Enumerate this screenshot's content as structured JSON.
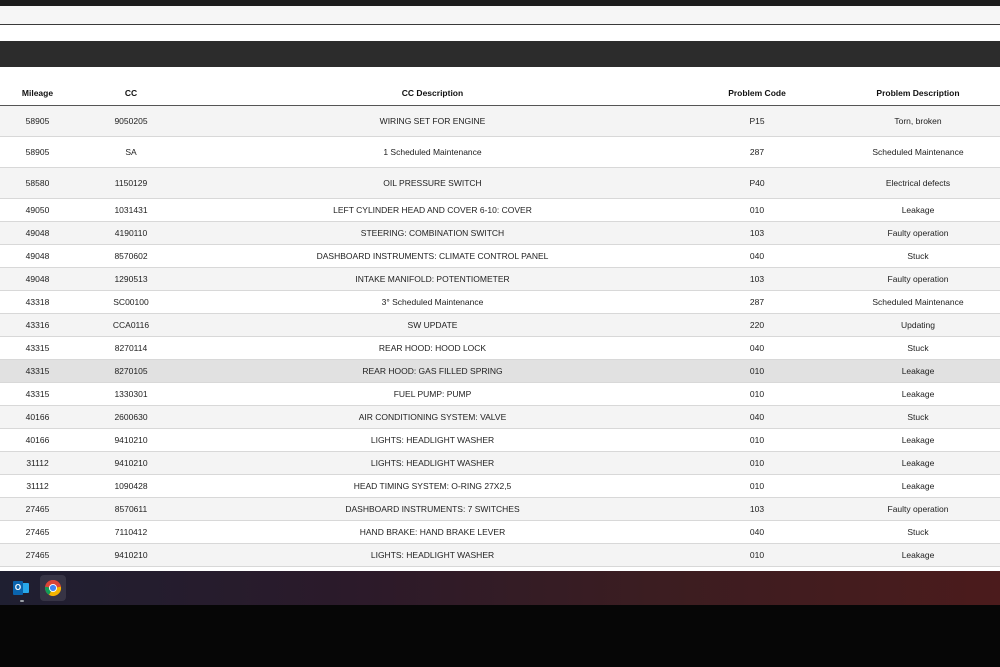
{
  "table": {
    "headers": {
      "mileage": "Mileage",
      "cc": "CC",
      "cc_description": "CC Description",
      "problem_code": "Problem Code",
      "problem_description": "Problem Description"
    },
    "rows": [
      {
        "mileage": "58905",
        "cc": "9050205",
        "cc_description": "WIRING SET FOR ENGINE",
        "problem_code": "P15",
        "problem_description": "Torn, broken"
      },
      {
        "mileage": "58905",
        "cc": "SA",
        "cc_description": "1 Scheduled Maintenance",
        "problem_code": "287",
        "problem_description": "Scheduled Maintenance"
      },
      {
        "mileage": "58580",
        "cc": "1150129",
        "cc_description": "OIL PRESSURE SWITCH",
        "problem_code": "P40",
        "problem_description": "Electrical defects"
      },
      {
        "mileage": "49050",
        "cc": "1031431",
        "cc_description": "LEFT CYLINDER HEAD AND COVER 6-10: COVER",
        "problem_code": "010",
        "problem_description": "Leakage"
      },
      {
        "mileage": "49048",
        "cc": "4190110",
        "cc_description": "STEERING: COMBINATION SWITCH",
        "problem_code": "103",
        "problem_description": "Faulty operation"
      },
      {
        "mileage": "49048",
        "cc": "8570602",
        "cc_description": "DASHBOARD INSTRUMENTS: CLIMATE CONTROL PANEL",
        "problem_code": "040",
        "problem_description": "Stuck"
      },
      {
        "mileage": "49048",
        "cc": "1290513",
        "cc_description": "INTAKE MANIFOLD: POTENTIOMETER",
        "problem_code": "103",
        "problem_description": "Faulty operation"
      },
      {
        "mileage": "43318",
        "cc": "SC00100",
        "cc_description": "3° Scheduled Maintenance",
        "problem_code": "287",
        "problem_description": "Scheduled Maintenance"
      },
      {
        "mileage": "43316",
        "cc": "CCA0116",
        "cc_description": "SW UPDATE",
        "problem_code": "220",
        "problem_description": "Updating"
      },
      {
        "mileage": "43315",
        "cc": "8270114",
        "cc_description": "REAR HOOD: HOOD LOCK",
        "problem_code": "040",
        "problem_description": "Stuck"
      },
      {
        "mileage": "43315",
        "cc": "8270105",
        "cc_description": "REAR HOOD: GAS FILLED SPRING",
        "problem_code": "010",
        "problem_description": "Leakage"
      },
      {
        "mileage": "43315",
        "cc": "1330301",
        "cc_description": "FUEL PUMP: PUMP",
        "problem_code": "010",
        "problem_description": "Leakage"
      },
      {
        "mileage": "40166",
        "cc": "2600630",
        "cc_description": "AIR CONDITIONING SYSTEM: VALVE",
        "problem_code": "040",
        "problem_description": "Stuck"
      },
      {
        "mileage": "40166",
        "cc": "9410210",
        "cc_description": "LIGHTS: HEADLIGHT WASHER",
        "problem_code": "010",
        "problem_description": "Leakage"
      },
      {
        "mileage": "31112",
        "cc": "9410210",
        "cc_description": "LIGHTS: HEADLIGHT WASHER",
        "problem_code": "010",
        "problem_description": "Leakage"
      },
      {
        "mileage": "31112",
        "cc": "1090428",
        "cc_description": "HEAD TIMING SYSTEM: O-RING 27X2,5",
        "problem_code": "010",
        "problem_description": "Leakage"
      },
      {
        "mileage": "27465",
        "cc": "8570611",
        "cc_description": "DASHBOARD INSTRUMENTS: 7 SWITCHES",
        "problem_code": "103",
        "problem_description": "Faulty operation"
      },
      {
        "mileage": "27465",
        "cc": "7110412",
        "cc_description": "HAND BRAKE: HAND BRAKE LEVER",
        "problem_code": "040",
        "problem_description": "Stuck"
      },
      {
        "mileage": "27465",
        "cc": "9410210",
        "cc_description": "LIGHTS: HEADLIGHT WASHER",
        "problem_code": "010",
        "problem_description": "Leakage"
      }
    ]
  },
  "taskbar": {
    "apps": [
      {
        "name": "outlook-icon",
        "glyph": "O"
      },
      {
        "name": "chrome-icon"
      }
    ]
  },
  "colors": {
    "header_band": "#2c2c2c",
    "row_alt": "#f4f4f4",
    "row_highlight": "#e1e1e1"
  }
}
